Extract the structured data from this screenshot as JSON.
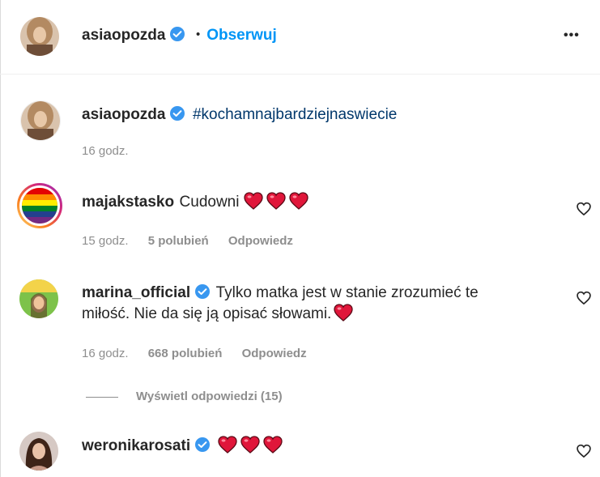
{
  "header": {
    "username": "asiaopozda",
    "dot": "•",
    "follow_label": "Obserwuj",
    "more_label": "•••"
  },
  "caption": {
    "username": "asiaopozda",
    "text": "#kochamnajbardziejnaswiecie",
    "time": "16 godz."
  },
  "comments": [
    {
      "username": "majakstasko",
      "text": "Cudowni",
      "hearts": 3,
      "time": "15 godz.",
      "likes": "5 polubień",
      "reply": "Odpowiedz"
    },
    {
      "username": "marina_official",
      "text_line1": "Tylko matka jest w stanie zrozumieć te",
      "text_line2": "miłość. Nie da się ją opisać słowami.",
      "time": "16 godz.",
      "likes": "668 polubień",
      "reply": "Odpowiedz",
      "view_replies": "Wyświetl odpowiedzi (15)"
    },
    {
      "username": "weronikarosati",
      "hearts": 3
    }
  ],
  "colors": {
    "accent": "#0095f6",
    "verified": "#3897f0",
    "heart": "#e0163a",
    "muted": "#8e8e8e"
  }
}
